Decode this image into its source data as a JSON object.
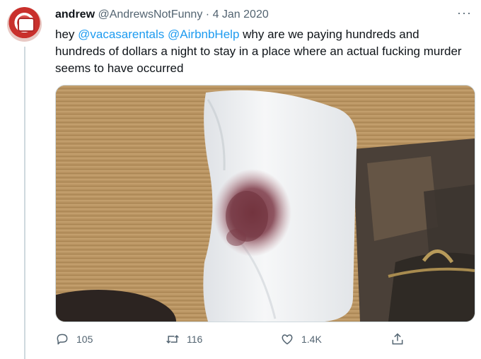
{
  "tweet": {
    "display_name": "andrew",
    "handle": "@AndrewsNotFunny",
    "separator": "·",
    "date": "4 Jan 2020",
    "more_label": "···",
    "text_prefix": "hey ",
    "mention_1": "@vacasarentals",
    "mention_2": "@AirbnbHelp",
    "text_rest": " why are we paying hundreds and hundreds of dollars a night to stay in a place where an actual fucking murder seems to have occurred"
  },
  "actions": {
    "reply_count": "105",
    "retweet_count": "116",
    "like_count": "1.4K"
  },
  "icons": [
    "reply-icon",
    "retweet-icon",
    "like-icon",
    "share-icon",
    "more-icon"
  ],
  "colors": {
    "link": "#1d9bf0",
    "meta": "#536471",
    "text": "#0f1419"
  }
}
